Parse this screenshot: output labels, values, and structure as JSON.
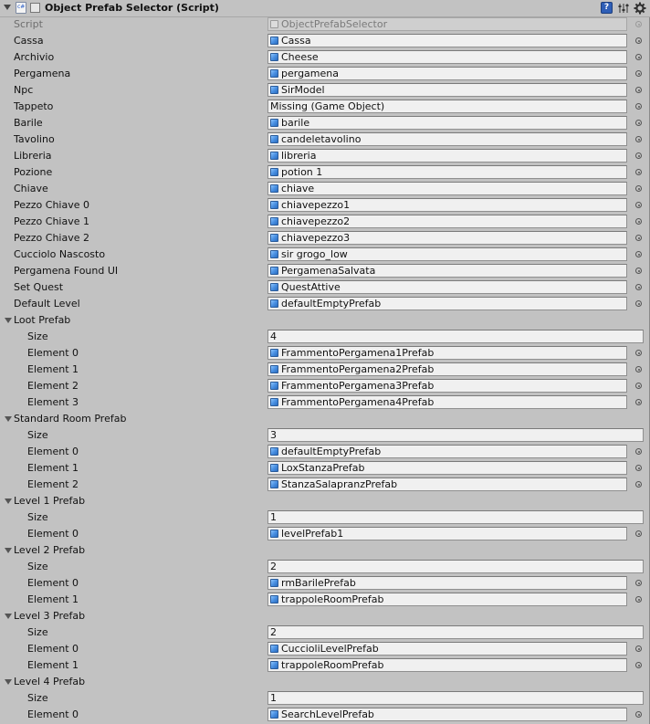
{
  "component": {
    "title": "Object Prefab Selector (Script)",
    "icons": {
      "fold": "triangle-down",
      "script": "csharp-script-icon",
      "help": "help-book-icon",
      "preset": "preset-sliders-icon",
      "settings": "gear-icon"
    },
    "help_label": "?"
  },
  "script_field": {
    "label": "Script",
    "value": "ObjectPrefabSelector"
  },
  "fields": [
    {
      "label": "Cassa",
      "value": "Cassa",
      "has_icon": true
    },
    {
      "label": "Archivio",
      "value": "Cheese",
      "has_icon": true
    },
    {
      "label": "Pergamena",
      "value": "pergamena",
      "has_icon": true
    },
    {
      "label": "Npc",
      "value": "SirModel",
      "has_icon": true
    },
    {
      "label": "Tappeto",
      "value": "Missing (Game Object)",
      "has_icon": false
    },
    {
      "label": "Barile",
      "value": "barile",
      "has_icon": true
    },
    {
      "label": "Tavolino",
      "value": "candeletavolino",
      "has_icon": true
    },
    {
      "label": "Libreria",
      "value": "libreria",
      "has_icon": true
    },
    {
      "label": "Pozione",
      "value": "potion 1",
      "has_icon": true
    },
    {
      "label": "Chiave",
      "value": "chiave",
      "has_icon": true
    },
    {
      "label": "Pezzo Chiave 0",
      "value": "chiavepezzo1",
      "has_icon": true
    },
    {
      "label": "Pezzo Chiave 1",
      "value": "chiavepezzo2",
      "has_icon": true
    },
    {
      "label": "Pezzo Chiave 2",
      "value": "chiavepezzo3",
      "has_icon": true
    },
    {
      "label": "Cucciolo Nascosto",
      "value": "sir grogo_low",
      "has_icon": true
    },
    {
      "label": "Pergamena Found UI",
      "value": "PergamenaSalvata",
      "has_icon": true
    },
    {
      "label": "Set Quest",
      "value": "QuestAttive",
      "has_icon": true
    },
    {
      "label": "Default Level",
      "value": "defaultEmptyPrefab",
      "has_icon": true
    }
  ],
  "arrays": [
    {
      "label": "Loot Prefab",
      "size_label": "Size",
      "size": "4",
      "elements": [
        {
          "label": "Element 0",
          "value": "FrammentoPergamena1Prefab"
        },
        {
          "label": "Element 1",
          "value": "FrammentoPergamena2Prefab"
        },
        {
          "label": "Element 2",
          "value": "FrammentoPergamena3Prefab"
        },
        {
          "label": "Element 3",
          "value": "FrammentoPergamena4Prefab"
        }
      ]
    },
    {
      "label": "Standard Room Prefab",
      "size_label": "Size",
      "size": "3",
      "elements": [
        {
          "label": "Element 0",
          "value": "defaultEmptyPrefab"
        },
        {
          "label": "Element 1",
          "value": "LoxStanzaPrefab"
        },
        {
          "label": "Element 2",
          "value": "StanzaSalapranzPrefab"
        }
      ]
    },
    {
      "label": "Level 1 Prefab",
      "size_label": "Size",
      "size": "1",
      "elements": [
        {
          "label": "Element 0",
          "value": "levelPrefab1"
        }
      ]
    },
    {
      "label": "Level 2 Prefab",
      "size_label": "Size",
      "size": "2",
      "elements": [
        {
          "label": "Element 0",
          "value": "rmBarilePrefab"
        },
        {
          "label": "Element 1",
          "value": "trappoleRoomPrefab"
        }
      ]
    },
    {
      "label": "Level 3 Prefab",
      "size_label": "Size",
      "size": "2",
      "elements": [
        {
          "label": "Element 0",
          "value": "CuccioliLevelPrefab"
        },
        {
          "label": "Element 1",
          "value": "trappoleRoomPrefab"
        }
      ]
    },
    {
      "label": "Level 4 Prefab",
      "size_label": "Size",
      "size": "1",
      "elements": [
        {
          "label": "Element 0",
          "value": "SearchLevelPrefab"
        }
      ]
    }
  ]
}
